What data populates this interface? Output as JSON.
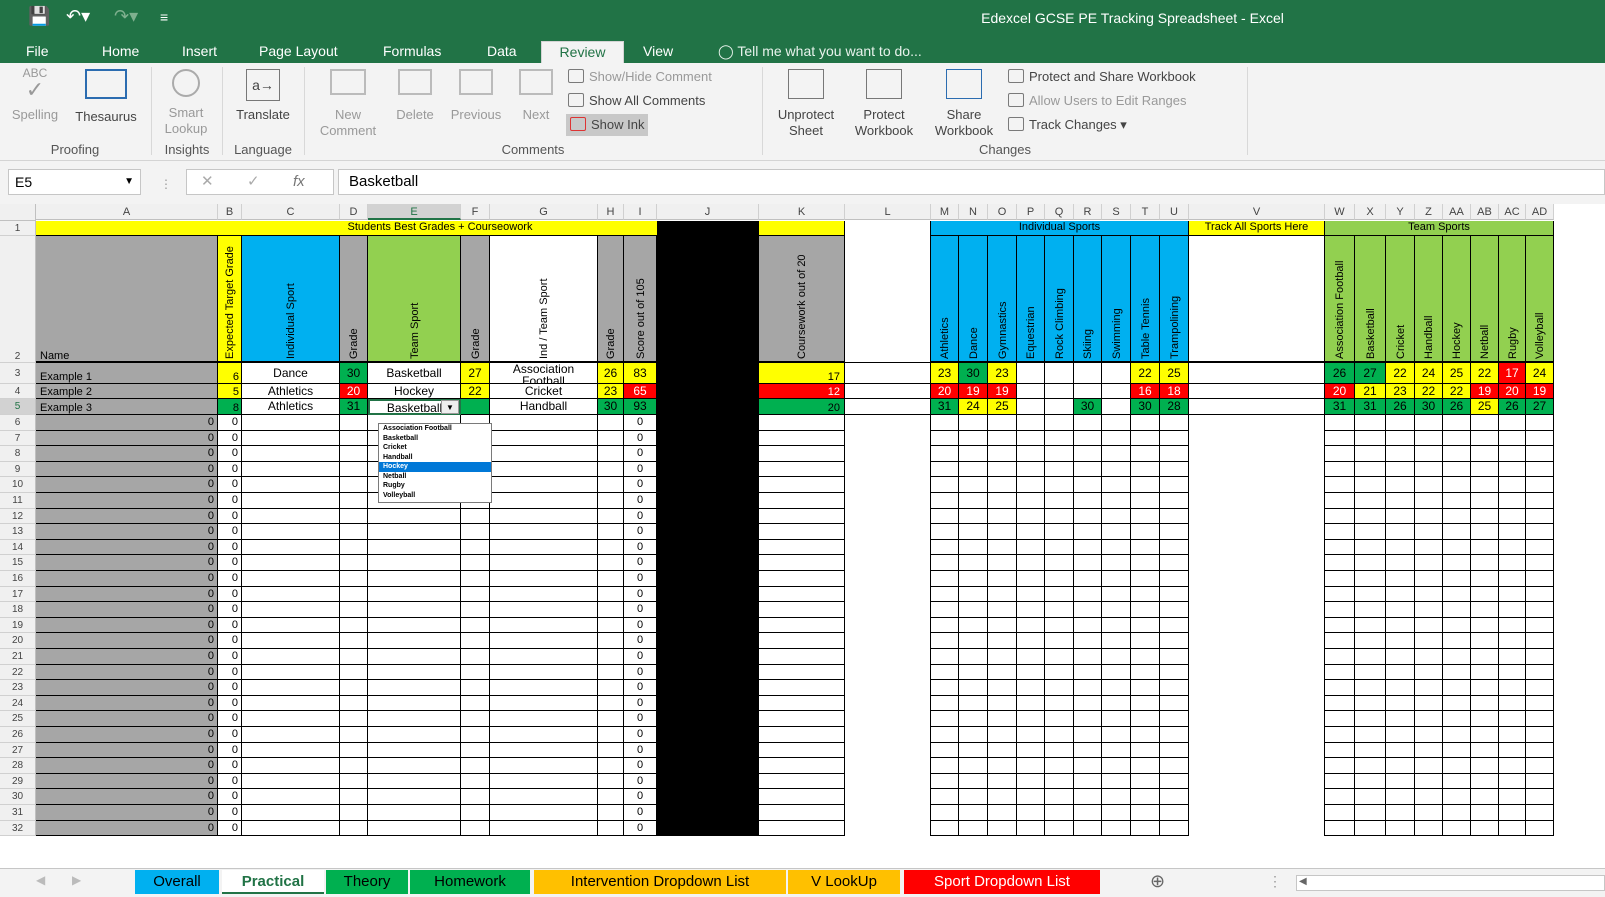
{
  "window": {
    "title": "Edexcel GCSE PE Tracking Spreadsheet - Excel"
  },
  "ribbon_tabs": [
    "File",
    "Home",
    "Insert",
    "Page Layout",
    "Formulas",
    "Data",
    "Review",
    "View"
  ],
  "tell_me": "Tell me what you want to do...",
  "groups": {
    "proofing": "Proofing",
    "insights": "Insights",
    "language": "Language",
    "comments": "Comments",
    "changes": "Changes"
  },
  "buttons": {
    "spelling": "Spelling",
    "spelling_abc": "ABC",
    "thesaurus": "Thesaurus",
    "smart_lookup": "Smart Lookup",
    "translate": "Translate",
    "new_comment": "New Comment",
    "delete": "Delete",
    "previous": "Previous",
    "next": "Next",
    "show_hide_comment": "Show/Hide Comment",
    "show_all_comments": "Show All Comments",
    "show_ink": "Show Ink",
    "unprotect_sheet": "Unprotect Sheet",
    "protect_workbook": "Protect Workbook",
    "share_workbook": "Share Workbook",
    "protect_share": "Protect and Share Workbook",
    "allow_edit": "Allow Users to Edit Ranges",
    "track_changes": "Track Changes"
  },
  "formula_bar": {
    "name_box": "E5",
    "formula": "Basketball",
    "fx": "fx"
  },
  "columns": [
    "A",
    "B",
    "C",
    "D",
    "E",
    "F",
    "G",
    "H",
    "I",
    "J",
    "K",
    "L",
    "M",
    "N",
    "O",
    "P",
    "Q",
    "R",
    "S",
    "T",
    "U",
    "V",
    "W",
    "X",
    "Y",
    "Z",
    "AA",
    "AB",
    "AC",
    "AD"
  ],
  "headers": {
    "best_grades": "Students Best Grades + Courseowork",
    "name": "Name",
    "expected": "Expected Target Grade",
    "individual_sport": "Individual Sport",
    "grade": "Grade",
    "team_sport": "Team Sport",
    "ind_team": "Ind / Team Sport",
    "score105": "Score out of 105",
    "coursework": "Coursework out of 20",
    "individual_sports": "Individual Sports",
    "track_all": "Track All Sports Here",
    "team_sports": "Team Sports"
  },
  "ind_sports": [
    "Athletics",
    "Dance",
    "Gymnastics",
    "Equestrian",
    "Rock Climbing",
    "Skiing",
    "Swimming",
    "Table Tennis",
    "Trampolining"
  ],
  "team_sports_list": [
    "Association Football",
    "Basketball",
    "Cricket",
    "Handball",
    "Hockey",
    "Netball",
    "Rugby",
    "Volleyball"
  ],
  "rows": [
    {
      "name": "Example 1",
      "target": "6",
      "ind": "Dance",
      "ind_grade": "30",
      "team": "Basketball",
      "team_grade": "27",
      "it": "Association Football",
      "it_grade": "26",
      "score": "83",
      "cw": "17",
      "isv": [
        "23",
        "30",
        "23",
        "",
        "",
        "",
        "",
        "22",
        "25"
      ],
      "tsv": [
        "26",
        "27",
        "22",
        "24",
        "25",
        "22",
        "17",
        "24"
      ]
    },
    {
      "name": "Example 2",
      "target": "5",
      "ind": "Athletics",
      "ind_grade": "20",
      "team": "Hockey",
      "team_grade": "22",
      "it": "Cricket",
      "it_grade": "23",
      "score": "65",
      "cw": "12",
      "isv": [
        "20",
        "19",
        "19",
        "",
        "",
        "",
        "",
        "16",
        "18"
      ],
      "tsv": [
        "20",
        "21",
        "23",
        "22",
        "22",
        "19",
        "20",
        "19"
      ]
    },
    {
      "name": "Example 3",
      "target": "8",
      "ind": "Athletics",
      "ind_grade": "31",
      "team": "Basketball",
      "team_grade": "",
      "it": "Handball",
      "it_grade": "30",
      "score": "93",
      "cw": "20",
      "isv": [
        "31",
        "24",
        "25",
        "",
        "",
        "30",
        "",
        "30",
        "28"
      ],
      "tsv": [
        "31",
        "31",
        "26",
        "30",
        "26",
        "25",
        "26",
        "27"
      ]
    }
  ],
  "empty_value": "0",
  "dropdown": [
    "Association Football",
    "Basketball",
    "Cricket",
    "Handball",
    "Hockey",
    "Netball",
    "Rugby",
    "Volleyball"
  ],
  "dropdown_selected": "Hockey",
  "sheet_tabs": [
    {
      "label": "Overall",
      "color": "#00b0f0"
    },
    {
      "label": "Practical",
      "color": "#ffffff"
    },
    {
      "label": "Theory",
      "color": "#00b050"
    },
    {
      "label": "Homework",
      "color": "#00b050"
    },
    {
      "label": "Intervention Dropdown List",
      "color": "#ffc000"
    },
    {
      "label": "V LookUp",
      "color": "#ffc000"
    },
    {
      "label": "Sport Dropdown List",
      "color": "#ff0000"
    }
  ]
}
